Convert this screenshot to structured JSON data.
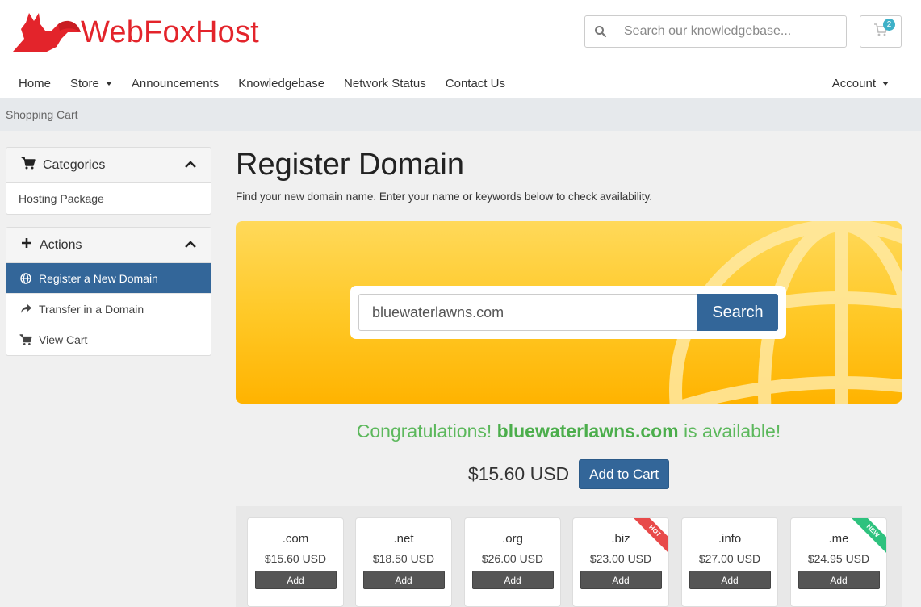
{
  "brand": {
    "name": "WebFoxHost",
    "color": "#e3242b"
  },
  "header": {
    "search_placeholder": "Search our knowledgebase...",
    "cart_count": "2"
  },
  "nav": {
    "items": [
      {
        "label": "Home"
      },
      {
        "label": "Store",
        "dropdown": true
      },
      {
        "label": "Announcements"
      },
      {
        "label": "Knowledgebase"
      },
      {
        "label": "Network Status"
      },
      {
        "label": "Contact Us"
      }
    ],
    "account_label": "Account"
  },
  "breadcrumb": "Shopping Cart",
  "sidebar": {
    "categories": {
      "title": "Categories",
      "items": [
        {
          "label": "Hosting Package"
        }
      ]
    },
    "actions": {
      "title": "Actions",
      "items": [
        {
          "label": "Register a New Domain",
          "icon": "globe-icon",
          "active": true
        },
        {
          "label": "Transfer in a Domain",
          "icon": "share-icon"
        },
        {
          "label": "View Cart",
          "icon": "cart-icon"
        }
      ]
    }
  },
  "main": {
    "title": "Register Domain",
    "subtitle": "Find your new domain name. Enter your name or keywords below to check availability.",
    "domain_value": "bluewaterlawns.com",
    "search_button": "Search",
    "result": {
      "prefix": "Congratulations!",
      "domain": "bluewaterlawns.com",
      "suffix": "is available!"
    },
    "price": "$15.60 USD",
    "add_to_cart": "Add to Cart",
    "accent_color": "#336699",
    "success_color": "#5cb85c"
  },
  "tlds": [
    {
      "name": ".com",
      "price": "$15.60 USD",
      "button": "Add",
      "badge": ""
    },
    {
      "name": ".net",
      "price": "$18.50 USD",
      "button": "Add",
      "badge": ""
    },
    {
      "name": ".org",
      "price": "$26.00 USD",
      "button": "Add",
      "badge": ""
    },
    {
      "name": ".biz",
      "price": "$23.00 USD",
      "button": "Add",
      "badge": "HOT"
    },
    {
      "name": ".info",
      "price": "$27.00 USD",
      "button": "Add",
      "badge": ""
    },
    {
      "name": ".me",
      "price": "$24.95 USD",
      "button": "Add",
      "badge": "NEW"
    }
  ]
}
